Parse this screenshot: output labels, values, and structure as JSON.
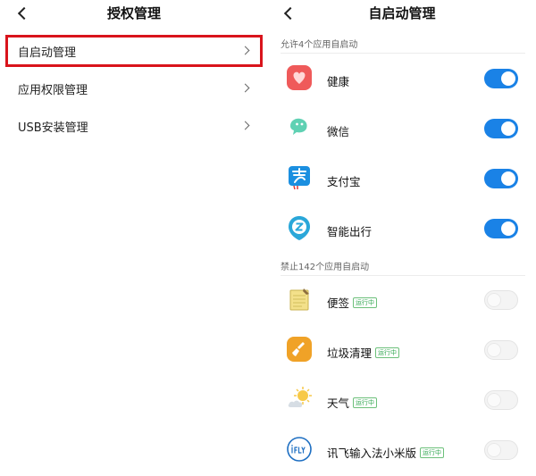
{
  "left": {
    "title": "授权管理",
    "items": [
      {
        "label": "自启动管理",
        "highlighted": true
      },
      {
        "label": "应用权限管理"
      },
      {
        "label": "USB安装管理"
      }
    ]
  },
  "right": {
    "title": "自启动管理",
    "allowed_header": "允许4个应用自启动",
    "forbidden_header": "禁止142个应用自启动",
    "running_badge": "运行中",
    "allowed_apps": [
      {
        "name": "健康",
        "icon": "health-icon",
        "enabled": true
      },
      {
        "name": "微信",
        "icon": "wechat-icon",
        "enabled": true
      },
      {
        "name": "支付宝",
        "icon": "alipay-icon",
        "enabled": true
      },
      {
        "name": "智能出行",
        "icon": "smart-travel-icon",
        "enabled": true
      }
    ],
    "forbidden_apps": [
      {
        "name": "便签",
        "icon": "notes-icon",
        "enabled": false,
        "running": true
      },
      {
        "name": "垃圾清理",
        "icon": "cleaner-icon",
        "enabled": false,
        "running": true
      },
      {
        "name": "天气",
        "icon": "weather-icon",
        "enabled": false,
        "running": true
      },
      {
        "name": "讯飞输入法小米版",
        "icon": "ifly-icon",
        "enabled": false,
        "running": true
      }
    ]
  },
  "colors": {
    "highlight_border": "#d9141c",
    "toggle_on": "#1a82e6",
    "running_badge": "#34a853"
  }
}
